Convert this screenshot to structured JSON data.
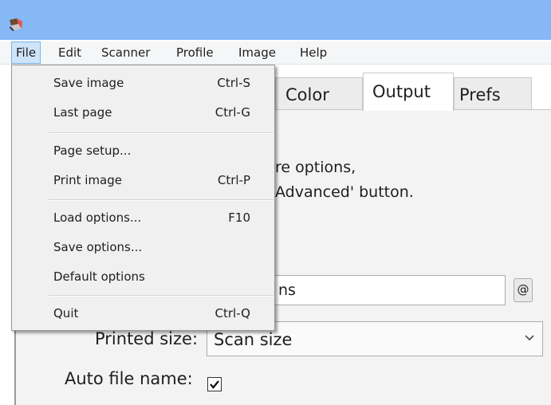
{
  "menubar": {
    "items": [
      {
        "label": "File"
      },
      {
        "label": "Edit"
      },
      {
        "label": "Scanner"
      },
      {
        "label": "Profile"
      },
      {
        "label": "Image"
      },
      {
        "label": "Help"
      }
    ],
    "active": "File"
  },
  "file_menu": {
    "items": [
      {
        "label": "Save image",
        "shortcut": "Ctrl-S"
      },
      {
        "label": "Last page",
        "shortcut": "Ctrl-G"
      },
      {
        "label": "Page setup...",
        "shortcut": ""
      },
      {
        "label": "Print image",
        "shortcut": "Ctrl-P"
      },
      {
        "label": "Load options...",
        "shortcut": "F10"
      },
      {
        "label": "Save options...",
        "shortcut": ""
      },
      {
        "label": "Default options",
        "shortcut": ""
      },
      {
        "label": "Quit",
        "shortcut": "Ctrl-Q"
      }
    ]
  },
  "tabs": [
    {
      "label": "Color",
      "selected": false
    },
    {
      "label": "Output",
      "selected": true
    },
    {
      "label": "Prefs",
      "selected": false
    }
  ],
  "info": {
    "line1": "re options,",
    "line2": "Advanced' button."
  },
  "output": {
    "filename_value": "ns",
    "at_button_label": "@",
    "printed_size_label": "Printed size:",
    "printed_size_value": "Scan size",
    "auto_file_name_label": "Auto file name:",
    "auto_file_name_checked": true
  },
  "colors": {
    "titlebar": "#85b8f5",
    "menu_highlight": "#cfe4f9",
    "menu_highlight_border": "#79b5ec",
    "panel_bg": "#f3f3f3"
  },
  "icons": {
    "app": "scanner-app-icon",
    "select_arrow": "chevron-down-icon",
    "checkbox": "checkmark-icon"
  }
}
